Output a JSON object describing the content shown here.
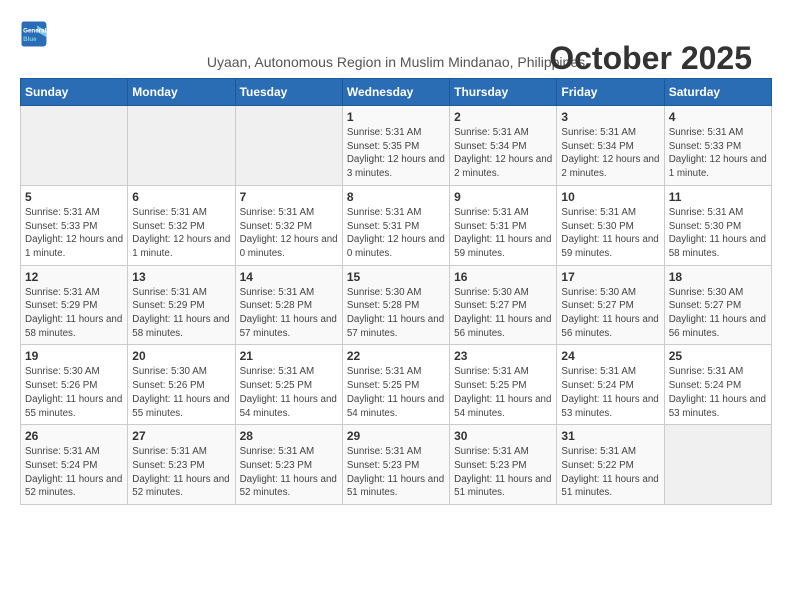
{
  "logo": {
    "line1": "General",
    "line2": "Blue"
  },
  "title": "October 2025",
  "subtitle": "Uyaan, Autonomous Region in Muslim Mindanao, Philippines",
  "days_of_week": [
    "Sunday",
    "Monday",
    "Tuesday",
    "Wednesday",
    "Thursday",
    "Friday",
    "Saturday"
  ],
  "weeks": [
    [
      {
        "day": "",
        "info": ""
      },
      {
        "day": "",
        "info": ""
      },
      {
        "day": "",
        "info": ""
      },
      {
        "day": "1",
        "info": "Sunrise: 5:31 AM\nSunset: 5:35 PM\nDaylight: 12 hours and 3 minutes."
      },
      {
        "day": "2",
        "info": "Sunrise: 5:31 AM\nSunset: 5:34 PM\nDaylight: 12 hours and 2 minutes."
      },
      {
        "day": "3",
        "info": "Sunrise: 5:31 AM\nSunset: 5:34 PM\nDaylight: 12 hours and 2 minutes."
      },
      {
        "day": "4",
        "info": "Sunrise: 5:31 AM\nSunset: 5:33 PM\nDaylight: 12 hours and 1 minute."
      }
    ],
    [
      {
        "day": "5",
        "info": "Sunrise: 5:31 AM\nSunset: 5:33 PM\nDaylight: 12 hours and 1 minute."
      },
      {
        "day": "6",
        "info": "Sunrise: 5:31 AM\nSunset: 5:32 PM\nDaylight: 12 hours and 1 minute."
      },
      {
        "day": "7",
        "info": "Sunrise: 5:31 AM\nSunset: 5:32 PM\nDaylight: 12 hours and 0 minutes."
      },
      {
        "day": "8",
        "info": "Sunrise: 5:31 AM\nSunset: 5:31 PM\nDaylight: 12 hours and 0 minutes."
      },
      {
        "day": "9",
        "info": "Sunrise: 5:31 AM\nSunset: 5:31 PM\nDaylight: 11 hours and 59 minutes."
      },
      {
        "day": "10",
        "info": "Sunrise: 5:31 AM\nSunset: 5:30 PM\nDaylight: 11 hours and 59 minutes."
      },
      {
        "day": "11",
        "info": "Sunrise: 5:31 AM\nSunset: 5:30 PM\nDaylight: 11 hours and 58 minutes."
      }
    ],
    [
      {
        "day": "12",
        "info": "Sunrise: 5:31 AM\nSunset: 5:29 PM\nDaylight: 11 hours and 58 minutes."
      },
      {
        "day": "13",
        "info": "Sunrise: 5:31 AM\nSunset: 5:29 PM\nDaylight: 11 hours and 58 minutes."
      },
      {
        "day": "14",
        "info": "Sunrise: 5:31 AM\nSunset: 5:28 PM\nDaylight: 11 hours and 57 minutes."
      },
      {
        "day": "15",
        "info": "Sunrise: 5:30 AM\nSunset: 5:28 PM\nDaylight: 11 hours and 57 minutes."
      },
      {
        "day": "16",
        "info": "Sunrise: 5:30 AM\nSunset: 5:27 PM\nDaylight: 11 hours and 56 minutes."
      },
      {
        "day": "17",
        "info": "Sunrise: 5:30 AM\nSunset: 5:27 PM\nDaylight: 11 hours and 56 minutes."
      },
      {
        "day": "18",
        "info": "Sunrise: 5:30 AM\nSunset: 5:27 PM\nDaylight: 11 hours and 56 minutes."
      }
    ],
    [
      {
        "day": "19",
        "info": "Sunrise: 5:30 AM\nSunset: 5:26 PM\nDaylight: 11 hours and 55 minutes."
      },
      {
        "day": "20",
        "info": "Sunrise: 5:30 AM\nSunset: 5:26 PM\nDaylight: 11 hours and 55 minutes."
      },
      {
        "day": "21",
        "info": "Sunrise: 5:31 AM\nSunset: 5:25 PM\nDaylight: 11 hours and 54 minutes."
      },
      {
        "day": "22",
        "info": "Sunrise: 5:31 AM\nSunset: 5:25 PM\nDaylight: 11 hours and 54 minutes."
      },
      {
        "day": "23",
        "info": "Sunrise: 5:31 AM\nSunset: 5:25 PM\nDaylight: 11 hours and 54 minutes."
      },
      {
        "day": "24",
        "info": "Sunrise: 5:31 AM\nSunset: 5:24 PM\nDaylight: 11 hours and 53 minutes."
      },
      {
        "day": "25",
        "info": "Sunrise: 5:31 AM\nSunset: 5:24 PM\nDaylight: 11 hours and 53 minutes."
      }
    ],
    [
      {
        "day": "26",
        "info": "Sunrise: 5:31 AM\nSunset: 5:24 PM\nDaylight: 11 hours and 52 minutes."
      },
      {
        "day": "27",
        "info": "Sunrise: 5:31 AM\nSunset: 5:23 PM\nDaylight: 11 hours and 52 minutes."
      },
      {
        "day": "28",
        "info": "Sunrise: 5:31 AM\nSunset: 5:23 PM\nDaylight: 11 hours and 52 minutes."
      },
      {
        "day": "29",
        "info": "Sunrise: 5:31 AM\nSunset: 5:23 PM\nDaylight: 11 hours and 51 minutes."
      },
      {
        "day": "30",
        "info": "Sunrise: 5:31 AM\nSunset: 5:23 PM\nDaylight: 11 hours and 51 minutes."
      },
      {
        "day": "31",
        "info": "Sunrise: 5:31 AM\nSunset: 5:22 PM\nDaylight: 11 hours and 51 minutes."
      },
      {
        "day": "",
        "info": ""
      }
    ]
  ]
}
